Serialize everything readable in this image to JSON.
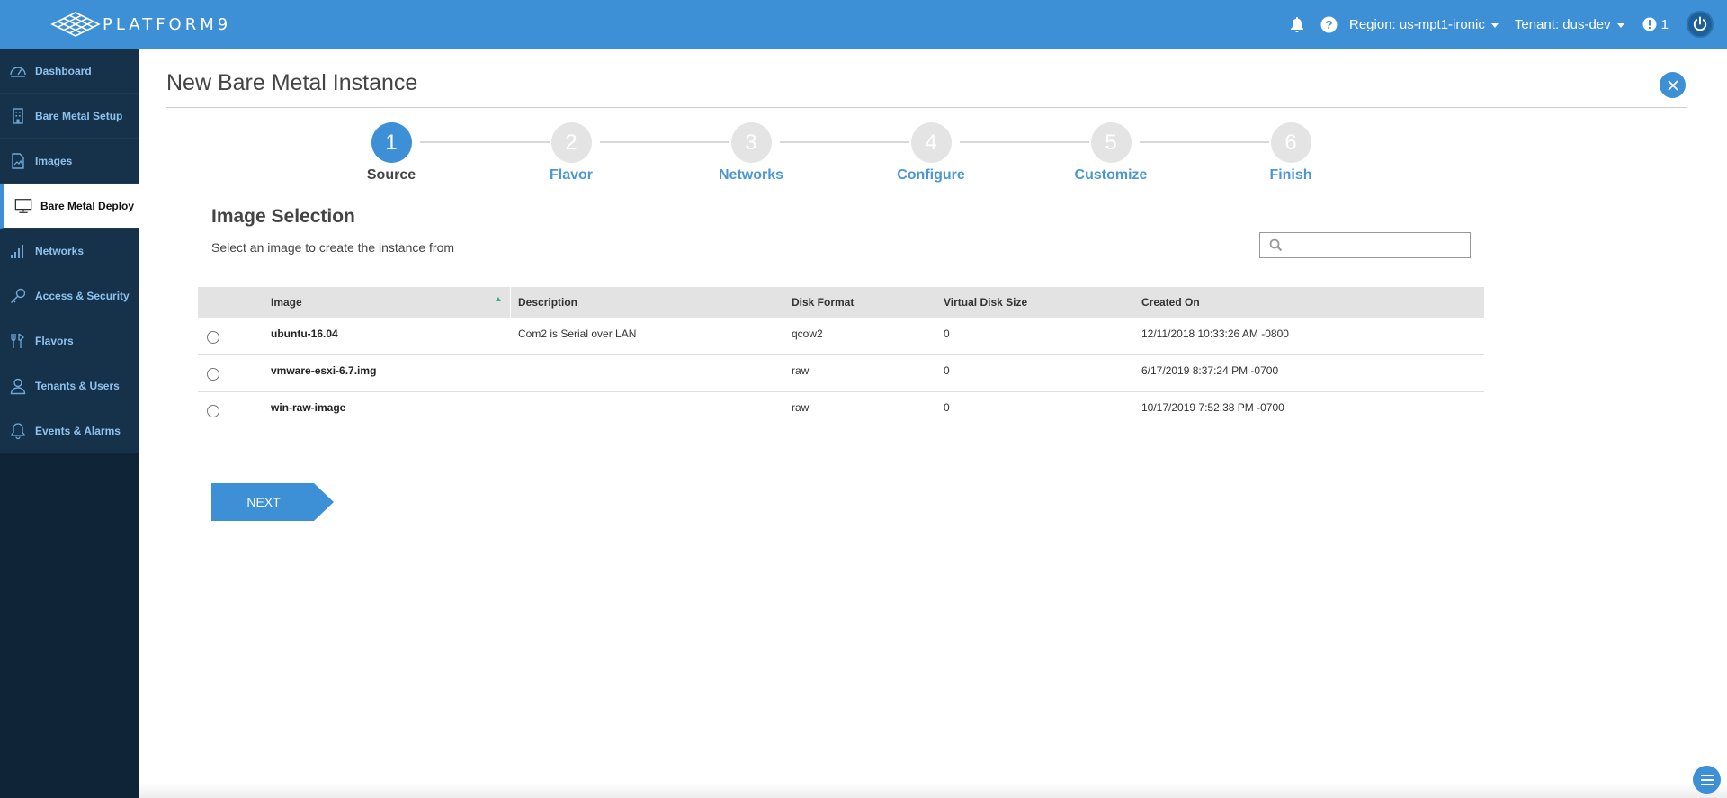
{
  "app": {
    "brand": "PLATFORM9",
    "colors": {
      "topbar": "#3d8fd6",
      "sidebar": "#0f2537",
      "accent": "#3d8fd6",
      "step_inactive": "#e4e4e4"
    }
  },
  "topbar": {
    "icons": [
      "bell-icon",
      "help-icon",
      "alert-icon",
      "power-icon"
    ],
    "region_label": "Region: us-mpt1-ironic",
    "tenant_label": "Tenant: dus-dev",
    "alert_count": "1"
  },
  "sidebar": {
    "items": [
      {
        "label": "Dashboard",
        "icon": "dashboard-icon",
        "active": false
      },
      {
        "label": "Bare Metal Setup",
        "icon": "building-icon",
        "active": false
      },
      {
        "label": "Images",
        "icon": "image-file-icon",
        "active": false
      },
      {
        "label": "Bare Metal Deploy",
        "icon": "monitor-icon",
        "active": true
      },
      {
        "label": "Networks",
        "icon": "signal-bars-icon",
        "active": false
      },
      {
        "label": "Access & Security",
        "icon": "key-icon",
        "active": false
      },
      {
        "label": "Flavors",
        "icon": "flavors-icon",
        "active": false
      },
      {
        "label": "Tenants & Users",
        "icon": "user-icon",
        "active": false
      },
      {
        "label": "Events & Alarms",
        "icon": "bell-icon",
        "active": false
      }
    ]
  },
  "page": {
    "title": "New Bare Metal Instance"
  },
  "wizard": {
    "current_step": 1,
    "steps": [
      {
        "number": "1",
        "label": "Source"
      },
      {
        "number": "2",
        "label": "Flavor"
      },
      {
        "number": "3",
        "label": "Networks"
      },
      {
        "number": "4",
        "label": "Configure"
      },
      {
        "number": "5",
        "label": "Customize"
      },
      {
        "number": "6",
        "label": "Finish"
      }
    ]
  },
  "image_selection": {
    "title": "Image Selection",
    "subtitle": "Select an image to create the instance from",
    "search_value": "",
    "columns": [
      "Image",
      "Description",
      "Disk Format",
      "Virtual Disk Size",
      "Created On"
    ],
    "sorted_by": "Image",
    "rows": [
      {
        "image": "ubuntu-16.04",
        "description": "Com2 is Serial over LAN",
        "disk_format": "qcow2",
        "virtual_disk_size": "0",
        "created_on": "12/11/2018 10:33:26 AM -0800",
        "selected": false
      },
      {
        "image": "vmware-esxi-6.7.img",
        "description": "",
        "disk_format": "raw",
        "virtual_disk_size": "0",
        "created_on": "6/17/2019 8:37:24 PM -0700",
        "selected": false
      },
      {
        "image": "win-raw-image",
        "description": "",
        "disk_format": "raw",
        "virtual_disk_size": "0",
        "created_on": "10/17/2019 7:52:38 PM -0700",
        "selected": false
      }
    ]
  },
  "actions": {
    "next_label": "NEXT"
  }
}
